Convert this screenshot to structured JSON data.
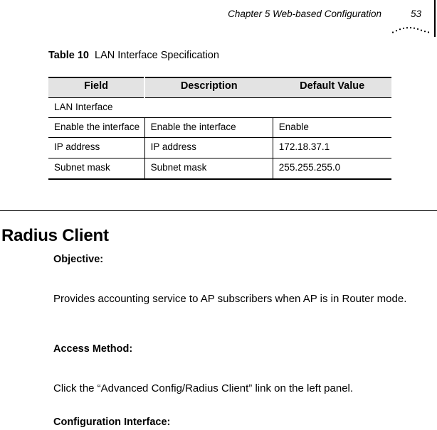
{
  "header": {
    "chapter_title": "Chapter 5 Web-based Configuration",
    "page_number": "53"
  },
  "table": {
    "caption_label": "Table 10",
    "caption_text": "LAN Interface Specification",
    "columns": [
      "Field",
      "Description",
      "Default Value"
    ],
    "group_label": "LAN Interface",
    "rows": [
      {
        "field": "Enable the interface",
        "description": "Enable the interface",
        "default": "Enable"
      },
      {
        "field": "IP address",
        "description": "IP address",
        "default": "172.18.37.1"
      },
      {
        "field": "Subnet mask",
        "description": "Subnet mask",
        "default": "255.255.255.0"
      }
    ]
  },
  "section": {
    "heading": "Radius Client",
    "objective_heading": "Objective:",
    "objective_text": "Provides accounting service to AP subscribers when AP is in Router mode.",
    "access_heading": "Access Method:",
    "access_text": "Click the “Advanced Config/Radius Client” link on the left panel.",
    "config_heading": "Configuration Interface:"
  },
  "colors": {
    "table_header_bg": "#e3e3e3",
    "text": "#000000",
    "rule": "#000000"
  }
}
